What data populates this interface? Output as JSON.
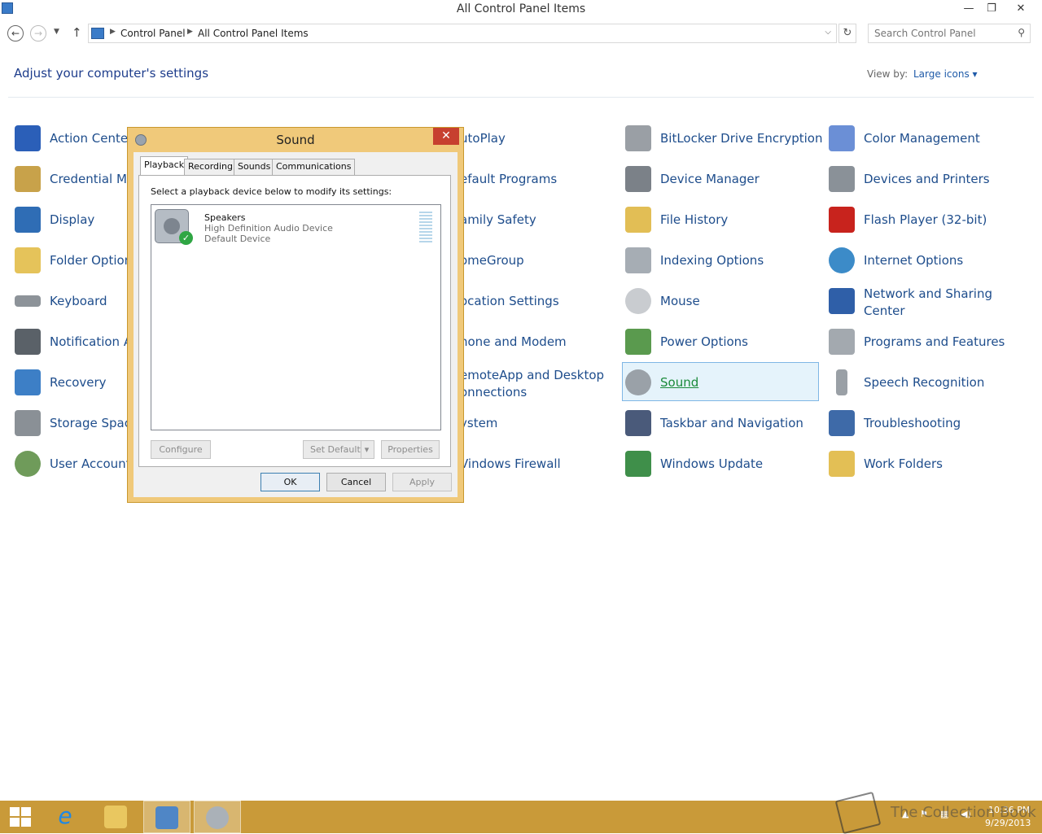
{
  "window": {
    "title": "All Control Panel Items",
    "minimize_glyph": "—",
    "restore_glyph": "❐",
    "close_glyph": "✕"
  },
  "address": {
    "back_glyph": "←",
    "forward_glyph": "→",
    "recent_glyph": "▼",
    "up_glyph": "↑",
    "crumbs": [
      "Control Panel",
      "All Control Panel Items"
    ],
    "crumb_sep": "▶",
    "dropdown_glyph": "⌵",
    "refresh_glyph": "↻"
  },
  "search": {
    "placeholder": "Search Control Panel",
    "icon": "⚲"
  },
  "header": {
    "heading": "Adjust your computer's settings",
    "view_by_label": "View by:",
    "view_by_value": "Large icons ▾"
  },
  "items": {
    "action_center": "Action Center",
    "credential_manager": "Credential Ma",
    "display": "Display",
    "folder_options": "Folder Option",
    "keyboard": "Keyboard",
    "notification_area": "Notification A",
    "recovery": "Recovery",
    "storage_spaces": "Storage Space",
    "user_accounts": "User Account",
    "autoplay": "utoPlay",
    "default_programs": "efault Programs",
    "family_safety": "amily Safety",
    "homegroup": "omeGroup",
    "location_settings": "ocation Settings",
    "phone_modem": "hone and Modem",
    "remoteapp": "emoteApp and Desktop onnections",
    "system": "ystem",
    "windows_firewall": "Vindows Firewall",
    "bitlocker": "BitLocker Drive Encryption",
    "device_manager": "Device Manager",
    "file_history": "File History",
    "indexing_options": "Indexing Options",
    "mouse": "Mouse",
    "power_options": "Power Options",
    "sound": "Sound",
    "taskbar_navigation": "Taskbar and Navigation",
    "windows_update": "Windows Update",
    "color_management": "Color Management",
    "devices_printers": "Devices and Printers",
    "flash_player": "Flash Player (32-bit)",
    "internet_options": "Internet Options",
    "network_sharing": "Network and Sharing Center",
    "programs_features": "Programs and Features",
    "speech_recognition": "Speech Recognition",
    "troubleshooting": "Troubleshooting",
    "work_folders": "Work Folders"
  },
  "dialog": {
    "title": "Sound",
    "close_glyph": "✕",
    "tabs": [
      "Playback",
      "Recording",
      "Sounds",
      "Communications"
    ],
    "instruction": "Select a playback device below to modify its settings:",
    "device": {
      "name": "Speakers",
      "line1": "High Definition Audio Device",
      "line2": "Default Device",
      "check_glyph": "✓"
    },
    "buttons": {
      "configure": "Configure",
      "set_default": "Set Default",
      "set_default_arrow": "▾",
      "properties": "Properties",
      "ok": "OK",
      "cancel": "Cancel",
      "apply": "Apply"
    }
  },
  "taskbar": {
    "watermark": "The Collection Book",
    "time": "10:36 PM",
    "date": "9/29/2013",
    "ie_glyph": "e"
  },
  "colors": {
    "link_blue": "#1e4d8c",
    "dialog_frame": "#f0c97a",
    "close_red": "#c7402f",
    "taskbar": "#c99a39"
  }
}
